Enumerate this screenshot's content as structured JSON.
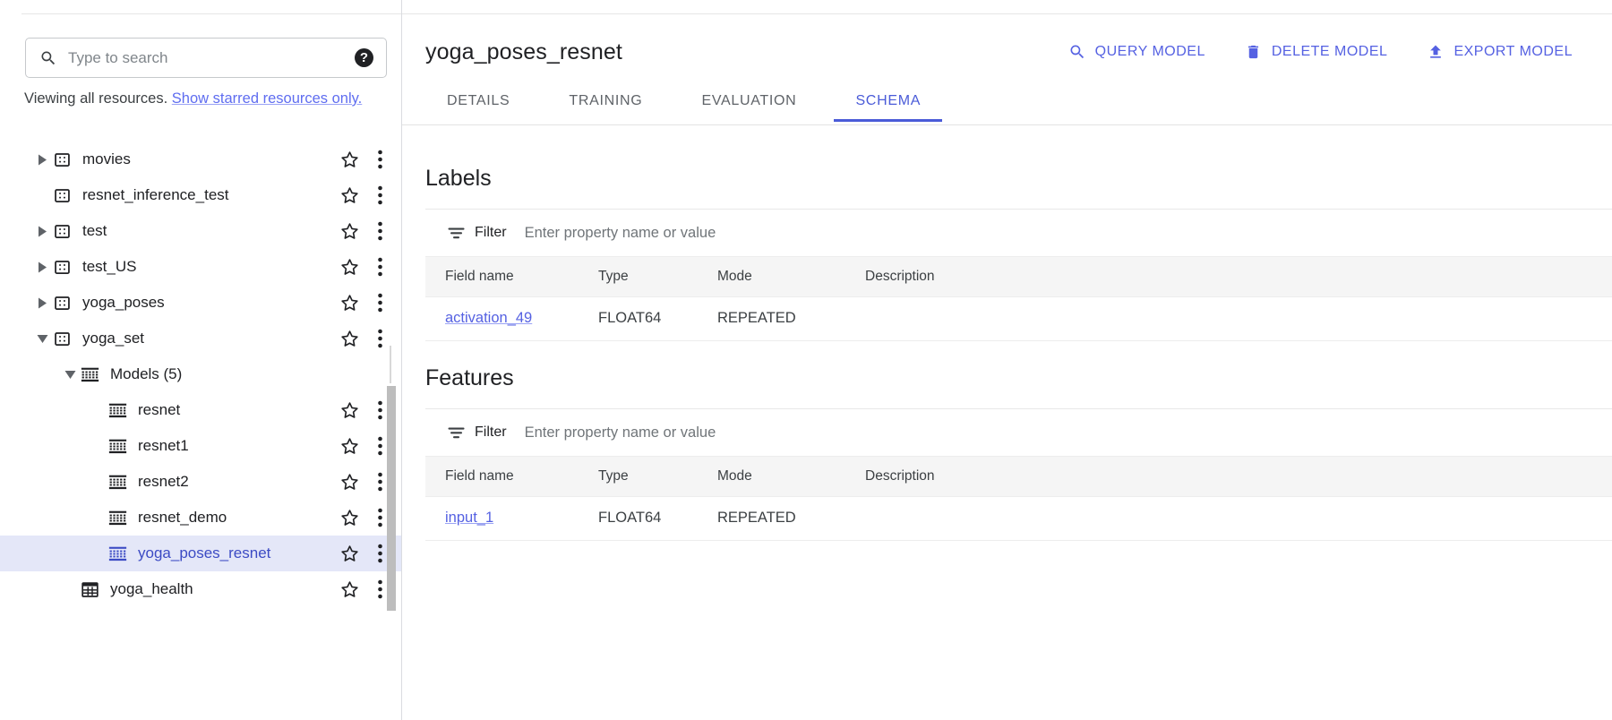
{
  "sidebar": {
    "search": {
      "placeholder": "Type to search",
      "value": "",
      "icon": "search-icon",
      "help_icon": "help-circle-icon"
    },
    "viewing_text": "Viewing all resources.",
    "viewing_link": "Show starred resources only.",
    "tree": [
      {
        "label": "movies",
        "icon": "dataset-icon",
        "twisty": "collapsed",
        "indent": 0,
        "selected": false
      },
      {
        "label": "resnet_inference_test",
        "icon": "dataset-icon",
        "twisty": "none",
        "indent": 0,
        "selected": false
      },
      {
        "label": "test",
        "icon": "dataset-icon",
        "twisty": "collapsed",
        "indent": 0,
        "selected": false
      },
      {
        "label": "test_US",
        "icon": "dataset-icon",
        "twisty": "collapsed",
        "indent": 0,
        "selected": false
      },
      {
        "label": "yoga_poses",
        "icon": "dataset-icon",
        "twisty": "collapsed",
        "indent": 0,
        "selected": false
      },
      {
        "label": "yoga_set",
        "icon": "dataset-icon",
        "twisty": "expanded",
        "indent": 0,
        "selected": false
      },
      {
        "label": "Models (5)",
        "icon": "model-icon",
        "twisty": "expanded",
        "indent": 1,
        "selected": false,
        "no_star": true
      },
      {
        "label": "resnet",
        "icon": "model-icon",
        "twisty": "none",
        "indent": 2,
        "selected": false
      },
      {
        "label": "resnet1",
        "icon": "model-icon",
        "twisty": "none",
        "indent": 2,
        "selected": false
      },
      {
        "label": "resnet2",
        "icon": "model-icon",
        "twisty": "none",
        "indent": 2,
        "selected": false
      },
      {
        "label": "resnet_demo",
        "icon": "model-icon",
        "twisty": "none",
        "indent": 2,
        "selected": false
      },
      {
        "label": "yoga_poses_resnet",
        "icon": "model-icon",
        "twisty": "none",
        "indent": 2,
        "selected": true
      },
      {
        "label": "yoga_health",
        "icon": "table-icon",
        "twisty": "none",
        "indent": 1,
        "selected": false
      }
    ]
  },
  "header": {
    "title": "yoga_poses_resnet",
    "actions": [
      {
        "label": "QUERY MODEL",
        "icon": "search-icon"
      },
      {
        "label": "DELETE MODEL",
        "icon": "trash-icon"
      },
      {
        "label": "EXPORT MODEL",
        "icon": "upload-icon"
      }
    ]
  },
  "tabs": [
    {
      "label": "DETAILS",
      "active": false
    },
    {
      "label": "TRAINING",
      "active": false
    },
    {
      "label": "EVALUATION",
      "active": false
    },
    {
      "label": "SCHEMA",
      "active": true
    }
  ],
  "sections": [
    {
      "title": "Labels",
      "filter": {
        "label": "Filter",
        "placeholder": "Enter property name or value",
        "value": "",
        "icon": "filter-icon"
      },
      "columns": [
        "Field name",
        "Type",
        "Mode",
        "Description"
      ],
      "rows": [
        {
          "field_name": "activation_49",
          "type": "FLOAT64",
          "mode": "REPEATED",
          "description": ""
        }
      ]
    },
    {
      "title": "Features",
      "filter": {
        "label": "Filter",
        "placeholder": "Enter property name or value",
        "value": "",
        "icon": "filter-icon"
      },
      "columns": [
        "Field name",
        "Type",
        "Mode",
        "Description"
      ],
      "rows": [
        {
          "field_name": "input_1",
          "type": "FLOAT64",
          "mode": "REPEATED",
          "description": ""
        }
      ]
    }
  ],
  "colors": {
    "accent": "#5561e2",
    "tab_active": "#4a5bd8",
    "selected_row_bg": "#e4e7f8",
    "table_header_bg": "#f5f5f5",
    "text_primary": "#202124",
    "text_secondary": "#5f6368"
  }
}
